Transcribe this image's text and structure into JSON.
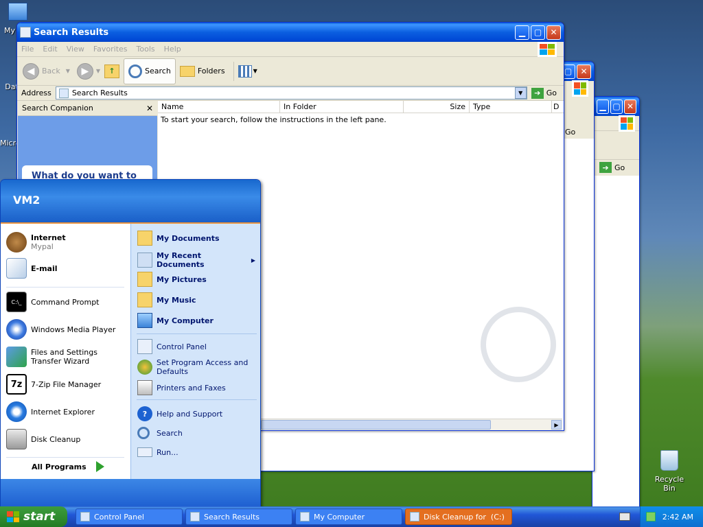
{
  "desktop": {
    "icons": [
      {
        "label": "My"
      },
      {
        "label": "Dat"
      },
      {
        "label": "Micro"
      },
      {
        "label": "Recycle Bin"
      }
    ]
  },
  "back_window_2": {
    "go_label": "Go"
  },
  "back_window_1": {
    "go_label": "Go"
  },
  "search_window": {
    "title": "Search Results",
    "menu": [
      "File",
      "Edit",
      "View",
      "Favorites",
      "Tools",
      "Help"
    ],
    "toolbar": {
      "back": "Back",
      "search": "Search",
      "folders": "Folders"
    },
    "address_label": "Address",
    "address_value": "Search Results",
    "go_label": "Go",
    "companion_title": "Search Companion",
    "companion_card_text": "What do you want to search for?",
    "columns": [
      "Name",
      "In Folder",
      "Size",
      "Type",
      "D"
    ],
    "empty_message": "To start your search, follow the instructions in the left pane."
  },
  "start_menu": {
    "user": "VM2",
    "pinned": [
      {
        "title": "Internet",
        "subtitle": "Mypal"
      },
      {
        "title": "E-mail"
      }
    ],
    "recent": [
      {
        "title": "Command Prompt"
      },
      {
        "title": "Windows Media Player"
      },
      {
        "title": "Files and Settings Transfer Wizard"
      },
      {
        "title": "7-Zip File Manager"
      },
      {
        "title": "Internet Explorer"
      },
      {
        "title": "Disk Cleanup"
      }
    ],
    "all_programs": "All Programs",
    "right": [
      {
        "label": "My Documents"
      },
      {
        "label": "My Recent Documents"
      },
      {
        "label": "My Pictures"
      },
      {
        "label": "My Music"
      },
      {
        "label": "My Computer"
      },
      {
        "label": "Control Panel"
      },
      {
        "label": "Set Program Access and Defaults"
      },
      {
        "label": "Printers and Faxes"
      },
      {
        "label": "Help and Support"
      },
      {
        "label": "Search"
      },
      {
        "label": "Run..."
      }
    ]
  },
  "taskbar": {
    "start_label": "start",
    "items": [
      {
        "label": "Control Panel"
      },
      {
        "label": "Search Results"
      },
      {
        "label": "My Computer"
      },
      {
        "label": "Disk Cleanup for  (C:)"
      }
    ],
    "clock": "2:42 AM"
  },
  "colors": {
    "accent": "#0054e3",
    "start_green": "#2e8a2e",
    "active_task": "#e46f20"
  }
}
